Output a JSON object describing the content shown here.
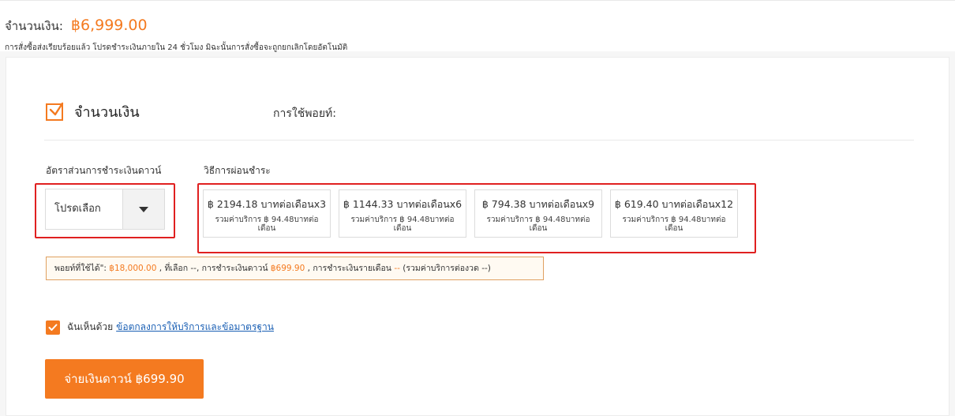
{
  "header": {
    "amount_label": "จำนวนเงิน:",
    "amount_value": "฿6,999.00",
    "notice": "การสั่งซื้อส่งเรียบร้อยแล้ว โปรดชำระเงินภายใน 24 ชั่วโมง มิฉะนั้นการสั่งซื้อจะถูกยกเลิกโดยอัตโนมัติ"
  },
  "section": {
    "title": "จำนวนเงิน",
    "points_label": "การใช้พอยท์:",
    "checked": true
  },
  "down_payment": {
    "label": "อัตราส่วนการชำระเงินดาวน์",
    "placeholder": "โปรดเลือก"
  },
  "installment": {
    "label": "วิธีการผ่อนชำระ",
    "plans": [
      {
        "main": "฿ 2194.18 บาทต่อเดือนx3",
        "sub": "รวมค่าบริการ ฿ 94.48บาทต่อเดือน"
      },
      {
        "main": "฿ 1144.33 บาทต่อเดือนx6",
        "sub": "รวมค่าบริการ ฿ 94.48บาทต่อเดือน"
      },
      {
        "main": "฿ 794.38 บาทต่อเดือนx9",
        "sub": "รวมค่าบริการ ฿ 94.48บาทต่อเดือน"
      },
      {
        "main": "฿ 619.40 บาทต่อเดือนx12",
        "sub": "รวมค่าบริการ ฿ 94.48บาทต่อเดือน"
      }
    ]
  },
  "info_bar": {
    "t1": "พอยท์ที่ใช้ได้\":",
    "points_available": "฿18,000.00",
    "t2": ", ที่เลือก --, การชำระเงินดาวน์",
    "down_amount": "฿699.90",
    "t3": ", การชำระเงินรายเดือน",
    "monthly": "--",
    "t4": "(รวมค่าบริการต่องวด --)"
  },
  "agreement": {
    "text": "ฉันเห็นด้วย",
    "link": "ข้อตกลงการให้บริการและข้อมาตรฐาน",
    "checked": true
  },
  "pay_button": {
    "label": "จ่ายเงินดาวน์ ฿699.90"
  },
  "colors": {
    "accent": "#f47a20",
    "highlight_border": "#e02020",
    "link": "#1a5fb4"
  }
}
